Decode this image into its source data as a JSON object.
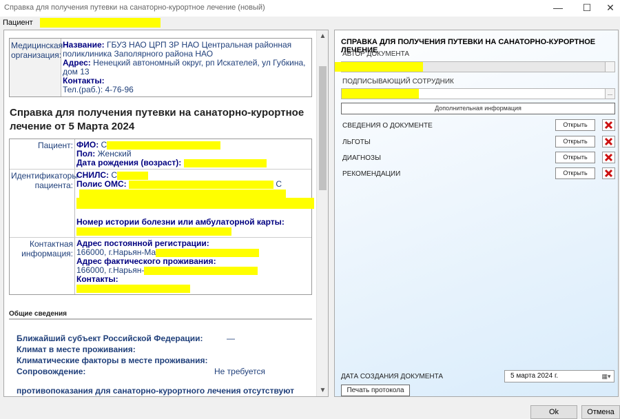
{
  "window": {
    "title": "Справка для получения путевки на санаторно-курортное лечение (новый)",
    "minimize": "—",
    "maximize": "☐",
    "close": "✕"
  },
  "patient_bar": {
    "label": "Пациент"
  },
  "org": {
    "label": "Медицинская организация:",
    "name_label": "Название:",
    "name": "ГБУЗ НАО ЦРП ЗР НАО Центральная районная поликлиника Заполярного района НАО",
    "address_label": "Адрес:",
    "address": "Ненецкий автономный округ, рп Искателей, ул Губкина, дом 13",
    "contacts_label": "Контакты:",
    "phone": "Тел.(раб.): 4-76-96"
  },
  "doc_title": "Справка для получения путевки на санаторно-курортное лечение от 5 Марта 2024",
  "patient": {
    "label": "Пациент:",
    "fio_label": "ФИО:",
    "fio": "С",
    "sex_label": "Пол:",
    "sex": "Женский",
    "birth_label": "Дата рождения (возраст):",
    "ids_label": "Идентификаторы пациента:",
    "snils_label": "СНИЛС:",
    "snils": "С",
    "oms_label": "Полис ОМС:",
    "oms_tail": "С",
    "history_label": "Номер истории болезни или амбулаторной карты:",
    "contact_label": "Контактная информация:",
    "reg_addr_label": "Адрес постоянной регистрации:",
    "reg_addr": "166000, г.Нарьян-Ма",
    "fact_addr_label": "Адрес фактического проживания:",
    "fact_addr": "166000, г.Нарьян-",
    "contacts_label": "Контакты:"
  },
  "general": {
    "header": "Общие сведения",
    "subject_label": "Ближайший субъект Российской Федерации:",
    "subject_value": "—",
    "climate_label": "Климат в месте проживания:",
    "factors_label": "Климатические факторы в месте проживания:",
    "escort_label": "Сопровождение:",
    "escort_value": "Не требуется",
    "contra": "противопоказания для санаторно-курортного лечения отсутствуют"
  },
  "right": {
    "title": "СПРАВКА ДЛЯ ПОЛУЧЕНИЯ ПУТЕВКИ НА САНАТОРНО-КУРОРТНОЕ ЛЕЧЕНИЕ",
    "author_label": "АВТОР ДОКУМЕНТА",
    "signer_label": "ПОДПИСЫВАЮЩИЙ СОТРУДНИК",
    "signer_btn": "...",
    "additional_info": "Дополнительная информация",
    "sections": [
      {
        "label": "СВЕДЕНИЯ О ДОКУМЕНТЕ",
        "open": "Открыть"
      },
      {
        "label": "ЛЬГОТЫ",
        "open": "Открыть"
      },
      {
        "label": "ДИАГНОЗЫ",
        "open": "Открыть"
      },
      {
        "label": "РЕКОМЕНДАЦИИ",
        "open": "Открыть"
      }
    ],
    "date_label": "ДАТА СОЗДАНИЯ ДОКУМЕНТА",
    "date_value": "5   марта   2024 г.",
    "print_button": "Печать протокола"
  },
  "footer": {
    "ok": "Ok",
    "cancel": "Отмена"
  },
  "colors": {
    "highlight": "#ffff00",
    "label_blue": "#1f3f7a",
    "delete_red": "#cc1111"
  }
}
